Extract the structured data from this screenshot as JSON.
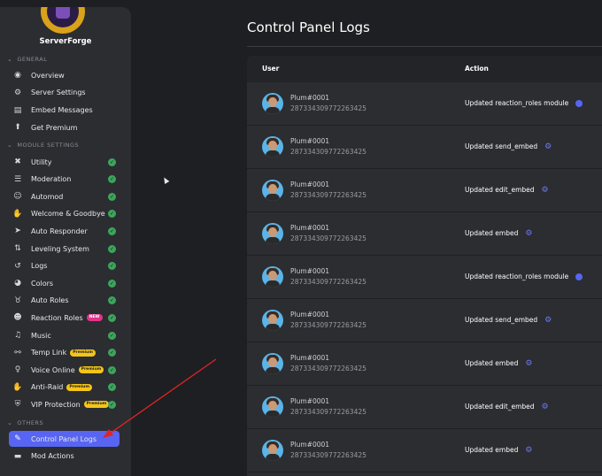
{
  "brand": {
    "name": "ServerForge"
  },
  "sections": {
    "general": "GENERAL",
    "module_settings": "MODULE SETTINGS",
    "others": "OTHERS"
  },
  "nav": {
    "general": [
      {
        "label": "Overview",
        "icon": "eye-icon"
      },
      {
        "label": "Server Settings",
        "icon": "gear-icon"
      },
      {
        "label": "Embed Messages",
        "icon": "embed-icon"
      },
      {
        "label": "Get Premium",
        "icon": "premium-icon"
      }
    ],
    "modules": [
      {
        "label": "Utility",
        "icon": "tools-icon",
        "enabled": true
      },
      {
        "label": "Moderation",
        "icon": "list-icon",
        "enabled": true
      },
      {
        "label": "Automod",
        "icon": "robot-icon",
        "enabled": true
      },
      {
        "label": "Welcome & Goodbye",
        "icon": "wave-icon",
        "enabled": true
      },
      {
        "label": "Auto Responder",
        "icon": "send-icon",
        "enabled": true
      },
      {
        "label": "Leveling System",
        "icon": "sort-up-icon",
        "enabled": true
      },
      {
        "label": "Logs",
        "icon": "history-icon",
        "enabled": true
      },
      {
        "label": "Colors",
        "icon": "palette-icon",
        "enabled": true
      },
      {
        "label": "Auto Roles",
        "icon": "medal-icon",
        "enabled": true
      },
      {
        "label": "Reaction Roles",
        "icon": "smile-icon",
        "enabled": true,
        "badge": "NEW"
      },
      {
        "label": "Music",
        "icon": "music-icon",
        "enabled": true
      },
      {
        "label": "Temp Link",
        "icon": "link-icon",
        "enabled": true,
        "badge": "Premium"
      },
      {
        "label": "Voice Online",
        "icon": "microphone-icon",
        "enabled": true,
        "badge": "Premium"
      },
      {
        "label": "Anti-Raid",
        "icon": "hand-icon",
        "enabled": true,
        "badge": "Premium"
      },
      {
        "label": "VIP Protection",
        "icon": "shield-icon",
        "enabled": true,
        "badge": "Premium"
      }
    ],
    "others": [
      {
        "label": "Control Panel Logs",
        "icon": "wrench-icon",
        "active": true
      },
      {
        "label": "Mod Actions",
        "icon": "file-icon"
      }
    ]
  },
  "page": {
    "title": "Control Panel Logs"
  },
  "table": {
    "columns": {
      "user": "User",
      "action": "Action"
    },
    "rows": [
      {
        "username": "Plum#0001",
        "user_id": "287334309772263425",
        "action": "Updated reaction_roles module",
        "action_icon": "smile"
      },
      {
        "username": "Plum#0001",
        "user_id": "287334309772263425",
        "action": "Updated send_embed",
        "action_icon": "gear"
      },
      {
        "username": "Plum#0001",
        "user_id": "287334309772263425",
        "action": "Updated edit_embed",
        "action_icon": "gear"
      },
      {
        "username": "Plum#0001",
        "user_id": "287334309772263425",
        "action": "Updated embed",
        "action_icon": "gear"
      },
      {
        "username": "Plum#0001",
        "user_id": "287334309772263425",
        "action": "Updated reaction_roles module",
        "action_icon": "smile"
      },
      {
        "username": "Plum#0001",
        "user_id": "287334309772263425",
        "action": "Updated send_embed",
        "action_icon": "gear"
      },
      {
        "username": "Plum#0001",
        "user_id": "287334309772263425",
        "action": "Updated embed",
        "action_icon": "gear"
      },
      {
        "username": "Plum#0001",
        "user_id": "287334309772263425",
        "action": "Updated edit_embed",
        "action_icon": "gear"
      },
      {
        "username": "Plum#0001",
        "user_id": "287334309772263425",
        "action": "Updated embed",
        "action_icon": "gear"
      }
    ]
  },
  "colors": {
    "accent": "#5865f2",
    "enabled": "#3ba55c",
    "premium_badge": "#f5c518",
    "new_badge": "#e0358b",
    "annotation_arrow": "#e02424"
  }
}
